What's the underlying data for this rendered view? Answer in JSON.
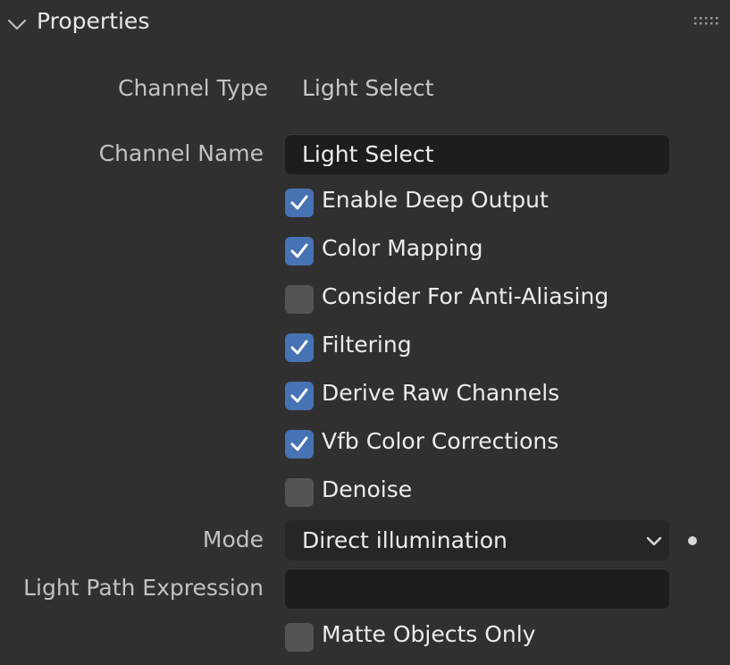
{
  "panel": {
    "title": "Properties"
  },
  "channel_type": {
    "label": "Channel Type",
    "value": "Light Select"
  },
  "channel_name": {
    "label": "Channel Name",
    "value": "Light Select"
  },
  "checkboxes": [
    {
      "label": "Enable Deep Output",
      "checked": true
    },
    {
      "label": "Color Mapping",
      "checked": true
    },
    {
      "label": "Consider For Anti-Aliasing",
      "checked": false
    },
    {
      "label": "Filtering",
      "checked": true
    },
    {
      "label": "Derive Raw Channels",
      "checked": true
    },
    {
      "label": "Vfb Color Corrections",
      "checked": true
    },
    {
      "label": "Denoise",
      "checked": false
    }
  ],
  "mode": {
    "label": "Mode",
    "value": "Direct illumination"
  },
  "light_path_expression": {
    "label": "Light Path Expression",
    "value": ""
  },
  "matte_objects_only": {
    "label": "Matte Objects Only",
    "checked": false
  },
  "icons": {
    "collapse": "chevron-down-icon",
    "drag": "grip-icon",
    "dropdown": "chevron-down-icon",
    "animate": "keyframe-dot-icon",
    "check": "checkmark-icon"
  },
  "colors": {
    "background": "#303030",
    "checkbox_on": "#4772b3",
    "checkbox_off": "#545454",
    "field": "#1d1d1d"
  }
}
